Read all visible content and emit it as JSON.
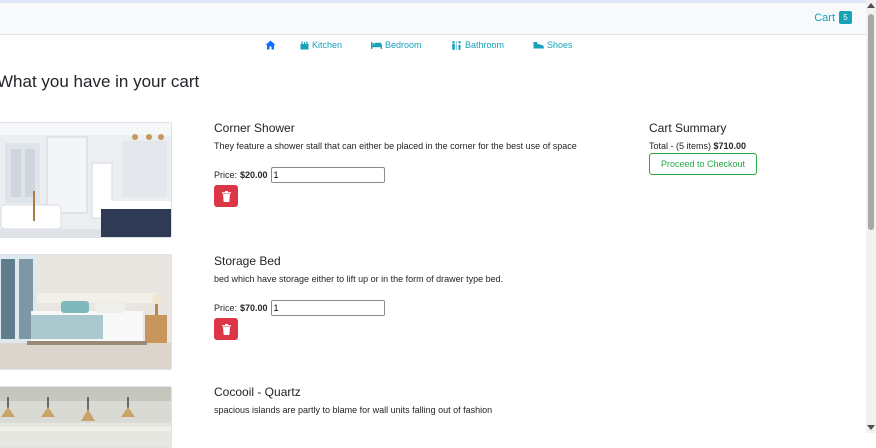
{
  "navbar": {
    "cart_label": "Cart",
    "cart_count": "5"
  },
  "nav": {
    "items": [
      {
        "label": "",
        "icon": "home-icon"
      },
      {
        "label": "Kitchen",
        "icon": "kitchen-icon"
      },
      {
        "label": "Bedroom",
        "icon": "bed-icon"
      },
      {
        "label": "Bathroom",
        "icon": "restroom-icon"
      },
      {
        "label": "Shoes",
        "icon": "shoe-icon"
      }
    ]
  },
  "page": {
    "title": "What you have in your cart"
  },
  "cart": {
    "price_label": "Price:",
    "items": [
      {
        "name": "Corner Shower",
        "description": "They feature a shower stall that can either be placed in the corner for the best use of space",
        "price": "$20.00",
        "qty": "1"
      },
      {
        "name": "Storage Bed",
        "description": "bed which have storage either to lift up or in the form of drawer type bed.",
        "price": "$70.00",
        "qty": "1"
      },
      {
        "name": "Cocooil - Quartz",
        "description": "spacious islands are partly to blame for wall units falling out of fashion",
        "price": "",
        "qty": ""
      }
    ]
  },
  "summary": {
    "title": "Cart Summary",
    "total_label": "Total - (5 items)",
    "total_value": "$710.00",
    "checkout_label": "Proceed to Checkout"
  },
  "colors": {
    "accent": "#17a2b8",
    "danger": "#dc3545",
    "success": "#28a745"
  }
}
